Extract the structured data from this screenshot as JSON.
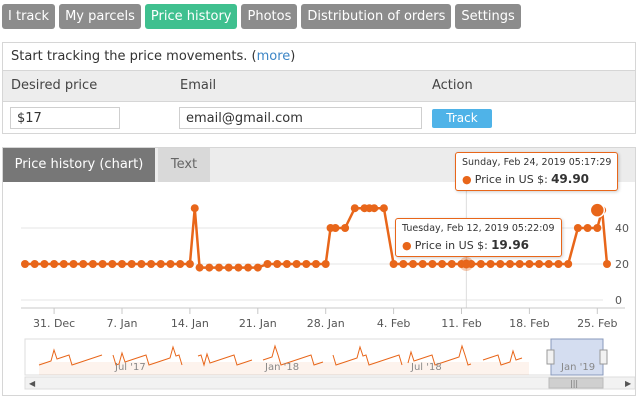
{
  "tabs": [
    {
      "label": "I track"
    },
    {
      "label": "My parcels"
    },
    {
      "label": "Price history"
    },
    {
      "label": "Photos"
    },
    {
      "label": "Distribution of orders"
    },
    {
      "label": "Settings"
    }
  ],
  "tracking": {
    "intro_text": "Start tracking the price movements. (",
    "intro_link": "more",
    "intro_close": ")",
    "col_price": "Desired price",
    "col_email": "Email",
    "col_action": "Action",
    "price_value": "$17",
    "email_value": "email@gmail.com",
    "track_label": "Track"
  },
  "chart_tabs": {
    "chart": "Price history (chart)",
    "text": "Text"
  },
  "tooltips": {
    "t1": {
      "date": "Tuesday, Feb 12, 2019 05:22:09",
      "label": "Price in US $:",
      "value": "19.96"
    },
    "t2": {
      "date": "Sunday, Feb 24, 2019 05:17:29",
      "label": "Price in US $:",
      "value": "49.90"
    }
  },
  "colors": {
    "series": "#e8661a",
    "tab_active": "#3fc08f",
    "tab_inactive": "#8c8c8c",
    "button": "#4fb3e8"
  },
  "chart_data": {
    "type": "line",
    "ylim": [
      0,
      40
    ],
    "y_ticks": [
      "0",
      "20",
      "40"
    ],
    "x_ticks": [
      "31. Dec",
      "7. Jan",
      "14. Jan",
      "21. Jan",
      "28. Jan",
      "4. Feb",
      "11. Feb",
      "18. Feb",
      "25. Feb"
    ],
    "x_tick_days": [
      -4,
      3,
      10,
      17,
      24,
      31,
      38,
      45,
      52
    ],
    "series": [
      {
        "x_days": [
          -7,
          -6,
          -5,
          -4,
          -3,
          -2,
          -1,
          0,
          1,
          2,
          3,
          4,
          5,
          6,
          7,
          8,
          9,
          10,
          10.5,
          11,
          12,
          13,
          14,
          15,
          16,
          17,
          18,
          19,
          20,
          21,
          22,
          23,
          24,
          24.5,
          25,
          26,
          27,
          28,
          28.5,
          29,
          30,
          31,
          32,
          33,
          34,
          35,
          36,
          37,
          38,
          39,
          40,
          41,
          42,
          43,
          44,
          45,
          46,
          47,
          48,
          49,
          50,
          51,
          52,
          52.5,
          53
        ],
        "y": [
          20,
          20,
          20,
          20,
          20,
          20,
          20,
          20,
          20,
          20,
          20,
          20,
          20,
          20,
          20,
          20,
          20,
          20,
          51,
          18,
          18,
          18,
          18,
          18,
          18,
          18,
          20,
          20,
          20,
          20,
          20,
          20,
          20,
          40,
          40,
          40,
          51,
          51,
          51,
          51,
          51,
          20,
          20,
          20,
          20,
          20,
          20,
          20,
          20,
          20,
          20,
          20,
          20,
          20,
          20,
          20,
          20,
          20,
          20,
          20,
          40,
          40,
          40,
          49.9,
          20,
          20
        ]
      }
    ],
    "navigator_labels": [
      "Jul '17",
      "Jan '18",
      "Jul '18",
      "Jan '19"
    ]
  }
}
